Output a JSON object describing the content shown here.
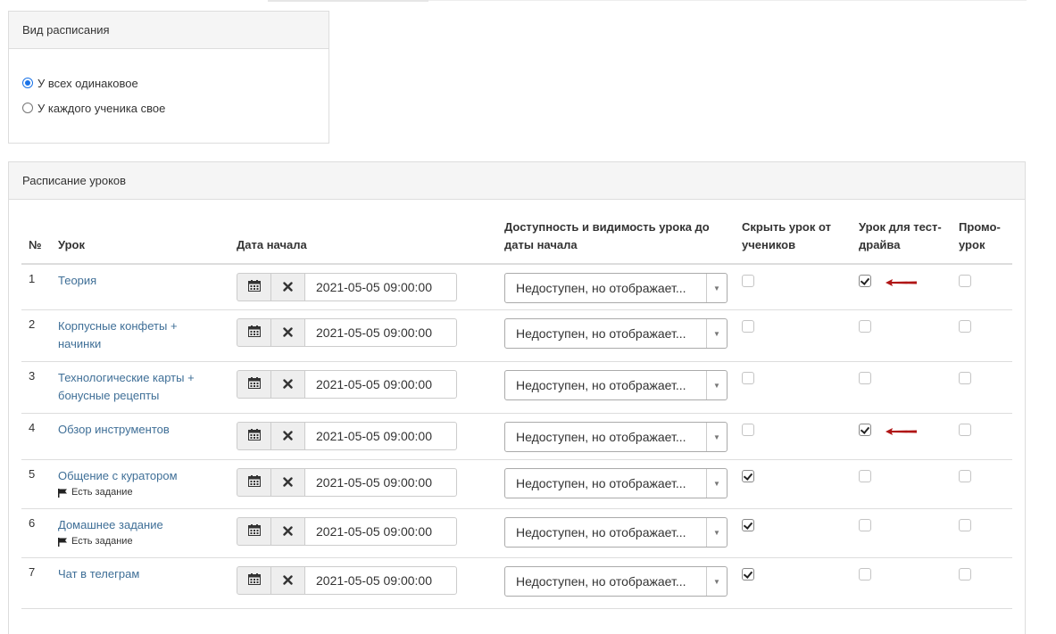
{
  "schedule_type": {
    "title": "Вид расписания",
    "options": [
      {
        "label": "У всех одинаковое",
        "selected": true
      },
      {
        "label": "У каждого ученика свое",
        "selected": false
      }
    ]
  },
  "lessons_schedule": {
    "title": "Расписание уроков",
    "columns": {
      "num": "№",
      "lesson": "Урок",
      "start_date": "Дата начала",
      "availability": "Доступность и видимость урока до даты начала",
      "hide": "Скрыть урок от учеников",
      "test_drive": "Урок для тест-драйва",
      "promo": "Промо-урок"
    },
    "task_label": "Есть задание",
    "rows": [
      {
        "num": "1",
        "name": "Теория",
        "task": "",
        "date": "2021-05-05 09:00:00",
        "availability": "Недоступен, но отображает...",
        "hide": false,
        "test_drive": true,
        "promo": false
      },
      {
        "num": "2",
        "name": "Корпусные конфеты + начинки",
        "task": "",
        "date": "2021-05-05 09:00:00",
        "availability": "Недоступен, но отображает...",
        "hide": false,
        "test_drive": false,
        "promo": false
      },
      {
        "num": "3",
        "name": "Технологические карты + бонусные рецепты",
        "task": "",
        "date": "2021-05-05 09:00:00",
        "availability": "Недоступен, но отображает...",
        "hide": false,
        "test_drive": false,
        "promo": false
      },
      {
        "num": "4",
        "name": "Обзор инструментов",
        "task": "",
        "date": "2021-05-05 09:00:00",
        "availability": "Недоступен, но отображает...",
        "hide": false,
        "test_drive": true,
        "promo": false
      },
      {
        "num": "5",
        "name": "Общение с куратором",
        "task": "Есть задание",
        "date": "2021-05-05 09:00:00",
        "availability": "Недоступен, но отображает...",
        "hide": true,
        "test_drive": false,
        "promo": false
      },
      {
        "num": "6",
        "name": "Домашнее задание",
        "task": "Есть задание",
        "date": "2021-05-05 09:00:00",
        "availability": "Недоступен, но отображает...",
        "hide": true,
        "test_drive": false,
        "promo": false
      },
      {
        "num": "7",
        "name": "Чат в телеграм",
        "task": "",
        "date": "2021-05-05 09:00:00",
        "availability": "Недоступен, но отображает...",
        "hide": true,
        "test_drive": false,
        "promo": false
      }
    ]
  },
  "icons": {
    "calendar": "calendar-icon",
    "clear": "close-icon",
    "dropdown": "caret-down-icon",
    "flag": "flag-icon",
    "annotation": "red-arrow-icon"
  },
  "colors": {
    "link": "#3f6f97",
    "accent": "#1a73e8",
    "annotation_arrow": "#b01515"
  }
}
